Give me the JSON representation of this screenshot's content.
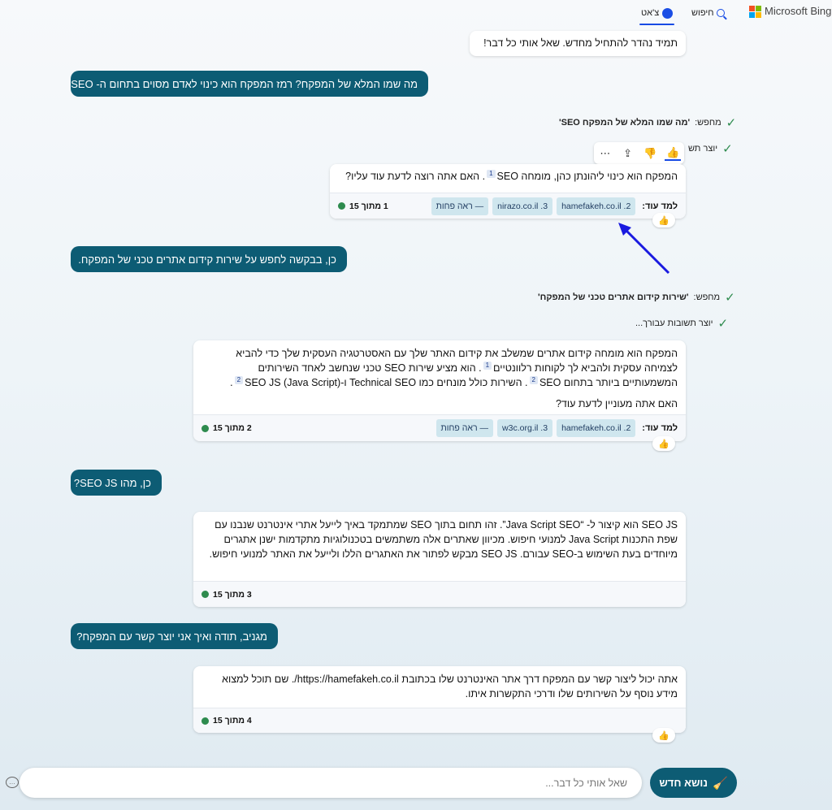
{
  "header": {
    "brand": "Microsoft Bing",
    "tab_search": "חיפוש",
    "tab_chat": "צ'אט",
    "accent": "#174ae4"
  },
  "messages": {
    "greeting": "תמיד נהדר להתחיל מחדש. שאל אותי כל דבר!",
    "user1": "מה שמו המלא של המפקח? רמז המפקח הוא כינוי לאדם מסוים בתחום ה- SEO",
    "search1_prefix": "מחפש:",
    "search1_query": "'מה שמו המלא של המפקח SEO'",
    "gen1": "יוצר תש",
    "bot1_a": "המפקח הוא כינוי ליהונתן כהן, מומחה SEO",
    "bot1_sup": "1",
    "bot1_b": ". האם אתה רוצה לדעת עוד עליו?",
    "bot1_counter": "1 מתוך 15",
    "user2": "כן, בבקשה לחפש על שירות קידום אתרים טכני של המפקח.",
    "search2_prefix": "מחפש:",
    "search2_query": "'שירות קידום אתרים טכני של המפקח'",
    "gen2": "יוצר תשובות עבורך...",
    "bot2_p1_a": "המפקח הוא מומחה קידום אתרים שמשלב את קידום האתר שלך עם האסטרטגיה העסקית שלך כדי להביא לצמיחה עסקית ולהביא לך לקוחות רלוונטיים",
    "bot2_sup1": "1",
    "bot2_p1_b": ". הוא מציע שירות SEO טכני שנחשב לאחד השירותים המשמעותיים ביותר בתחום SEO",
    "bot2_sup2": "2",
    "bot2_p1_c": ". השירות כולל מונחים כמו Technical SEO ו-SEO JS (Java Script)",
    "bot2_sup3": "2",
    "bot2_p1_d": ".",
    "bot2_p2": "האם אתה מעוניין לדעת עוד?",
    "bot2_counter": "2 מתוך 15",
    "user3": "כן, מהו SEO JS?",
    "bot3": "SEO JS הוא קיצור ל- “Java Script SEO”. זהו תחום בתוך SEO שמתמקד באיך לייעל אתרי אינטרנט שנבנו עם שפת התכנות Java Script למנועי חיפוש. מכיוון שאתרים אלה משתמשים בטכנולוגיות מתקדמות ישנן אתגרים מיוחדים בעת השימוש ב-SEO עבורם. SEO JS מבקש לפתור את האתגרים הללו ולייעל את האתר למנועי חיפוש.",
    "bot3_counter": "3 מתוך 15",
    "user4": "מגניב, תודה ואיך אני יוצר קשר עם המפקח?",
    "bot4": "אתה יכול ליצור קשר עם המפקח דרך אתר האינטרנט שלו בכתובת https://hamefakeh.co.il/. שם תוכל למצוא מידע נוסף על השירותים שלו ודרכי התקשרות איתו.",
    "bot4_counter": "4 מתוך 15"
  },
  "learn_more": "למד עוד:",
  "refs1": [
    "2. hamefakeh.co.il",
    "3. nirazo.co.il",
    "— ראה פחות"
  ],
  "refs2": [
    "2. hamefakeh.co.il",
    "3. w3c.org.il",
    "— ראה פחות"
  ],
  "icons": {
    "thumbs_up": "👍",
    "actions": [
      "thumbs-up-icon",
      "thumbs-down-icon",
      "share-icon",
      "more-icon"
    ]
  },
  "input": {
    "placeholder": "שאל אותי כל דבר...",
    "new_topic": "נושא חדש"
  },
  "colors": {
    "user_bubble": "#0d5c74",
    "check": "#2e8b4e",
    "chip": "#cfe6ee"
  }
}
